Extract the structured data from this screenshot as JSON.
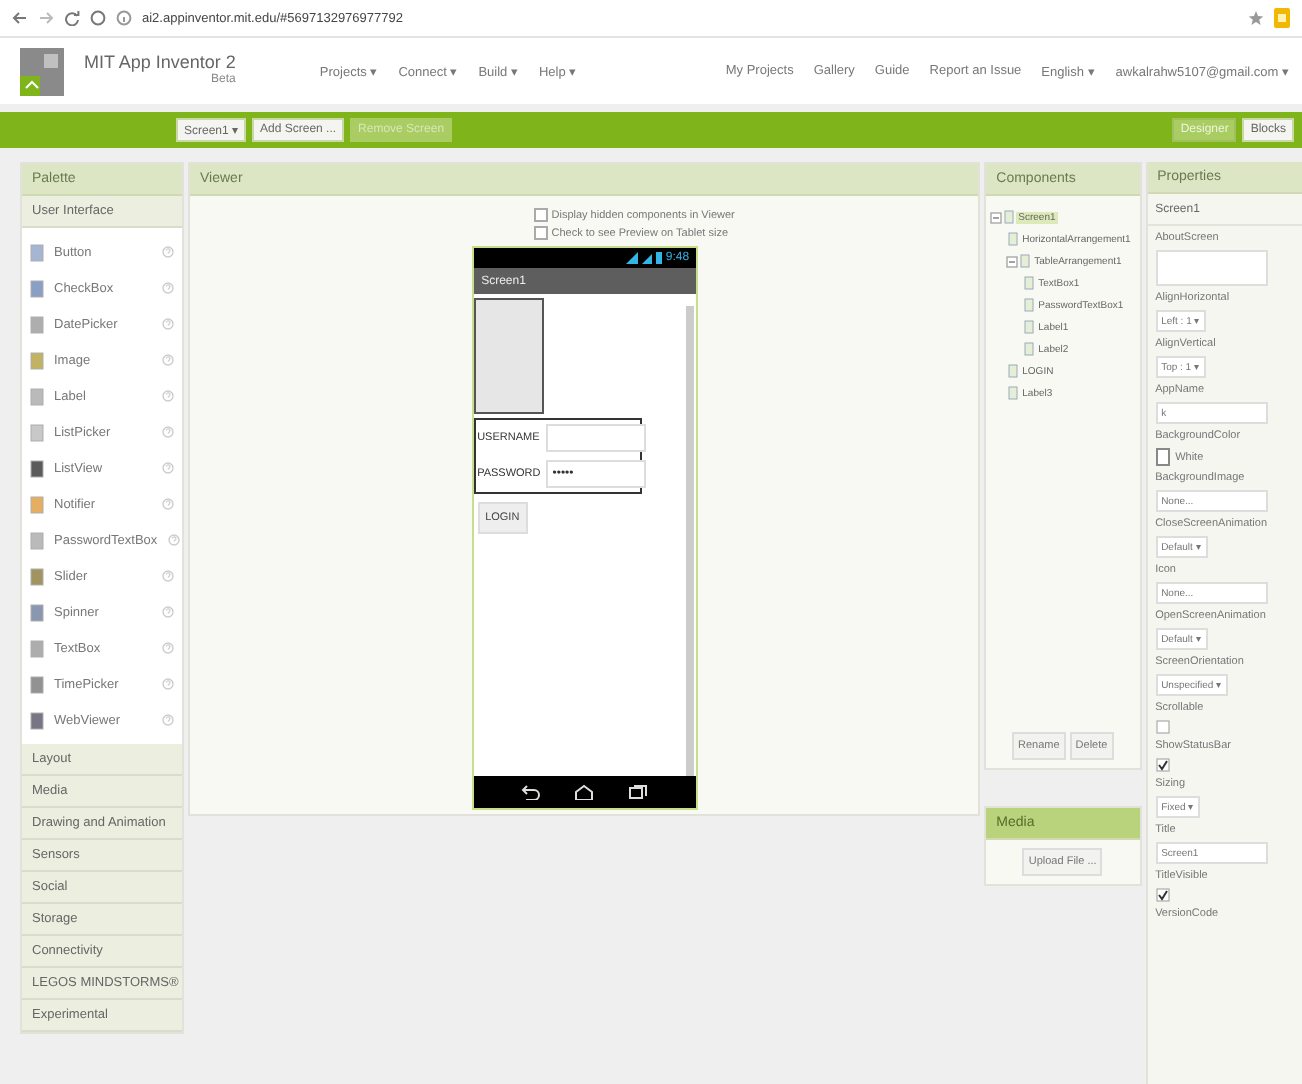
{
  "browser": {
    "url": "ai2.appinventor.mit.edu/#5697132976977792"
  },
  "header": {
    "title": "MIT App Inventor 2",
    "subtitle": "Beta",
    "menus": [
      "Projects ▾",
      "Connect ▾",
      "Build ▾",
      "Help ▾"
    ],
    "links": [
      "My Projects",
      "Gallery",
      "Guide",
      "Report an Issue",
      "English ▾",
      "awkalrahw5107@gmail.com ▾"
    ]
  },
  "toolbar": {
    "screen_buttons": [
      {
        "label": "Screen1 ▾",
        "disabled": false
      },
      {
        "label": "Add Screen ...",
        "disabled": false
      },
      {
        "label": "Remove Screen",
        "disabled": true
      }
    ],
    "views": [
      {
        "label": "Designer",
        "selected": true
      },
      {
        "label": "Blocks",
        "selected": false
      }
    ]
  },
  "palette": {
    "title": "Palette",
    "open_category": "User Interface",
    "items": [
      "Button",
      "CheckBox",
      "DatePicker",
      "Image",
      "Label",
      "ListPicker",
      "ListView",
      "Notifier",
      "PasswordTextBox",
      "Slider",
      "Spinner",
      "TextBox",
      "TimePicker",
      "WebViewer"
    ],
    "categories": [
      "Layout",
      "Media",
      "Drawing and Animation",
      "Sensors",
      "Social",
      "Storage",
      "Connectivity",
      "LEGOS MINDSTORMS®",
      "Experimental"
    ]
  },
  "viewer": {
    "title": "Viewer",
    "options": [
      {
        "label": "Display hidden components in Viewer",
        "checked": false
      },
      {
        "label": "Check to see Preview on Tablet size",
        "checked": false
      }
    ],
    "phone": {
      "time": "9:48",
      "screen_title": "Screen1",
      "fields": [
        {
          "label": "USERNAME"
        },
        {
          "label": "PASSWORD",
          "value": "•••••"
        }
      ],
      "button": "LOGIN"
    }
  },
  "components": {
    "title": "Components",
    "tree": [
      {
        "label": "Screen1",
        "selected": true,
        "expanded": true,
        "children": [
          {
            "label": "HorizontalArrangement1",
            "selected": false
          },
          {
            "label": "TableArrangement1",
            "selected": false,
            "expanded": true,
            "children": [
              {
                "label": "TextBox1",
                "selected": false
              },
              {
                "label": "PasswordTextBox1",
                "selected": false
              },
              {
                "label": "Label1",
                "selected": false
              },
              {
                "label": "Label2",
                "selected": false
              }
            ]
          },
          {
            "label": "LOGIN",
            "selected": false
          },
          {
            "label": "Label3",
            "selected": false
          }
        ]
      }
    ],
    "buttons": [
      "Rename",
      "Delete"
    ]
  },
  "media": {
    "title": "Media",
    "button": "Upload File ..."
  },
  "properties": {
    "title": "Properties",
    "component": "Screen1",
    "items": [
      {
        "name": "AboutScreen",
        "kind": "textarea"
      },
      {
        "name": "AlignHorizontal",
        "kind": "dropdown",
        "value": "Left : 1 ▾"
      },
      {
        "name": "AlignVertical",
        "kind": "dropdown",
        "value": "Top : 1 ▾"
      },
      {
        "name": "AppName",
        "kind": "text",
        "value": "k"
      },
      {
        "name": "BackgroundColor",
        "kind": "color",
        "value": "White",
        "color": "#ffffff"
      },
      {
        "name": "BackgroundImage",
        "kind": "text",
        "value": "None..."
      },
      {
        "name": "CloseScreenAnimation",
        "kind": "dropdown",
        "value": "Default ▾"
      },
      {
        "name": "Icon",
        "kind": "text",
        "value": "None..."
      },
      {
        "name": "OpenScreenAnimation",
        "kind": "dropdown",
        "value": "Default ▾"
      },
      {
        "name": "ScreenOrientation",
        "kind": "dropdown",
        "value": "Unspecified ▾"
      },
      {
        "name": "Scrollable",
        "kind": "checkbox",
        "checked": false
      },
      {
        "name": "ShowStatusBar",
        "kind": "checkbox",
        "checked": true
      },
      {
        "name": "Sizing",
        "kind": "dropdown",
        "value": "Fixed ▾"
      },
      {
        "name": "Title",
        "kind": "text",
        "value": "Screen1"
      },
      {
        "name": "TitleVisible",
        "kind": "checkbox",
        "checked": true
      },
      {
        "name": "VersionCode",
        "kind": "label"
      }
    ]
  }
}
